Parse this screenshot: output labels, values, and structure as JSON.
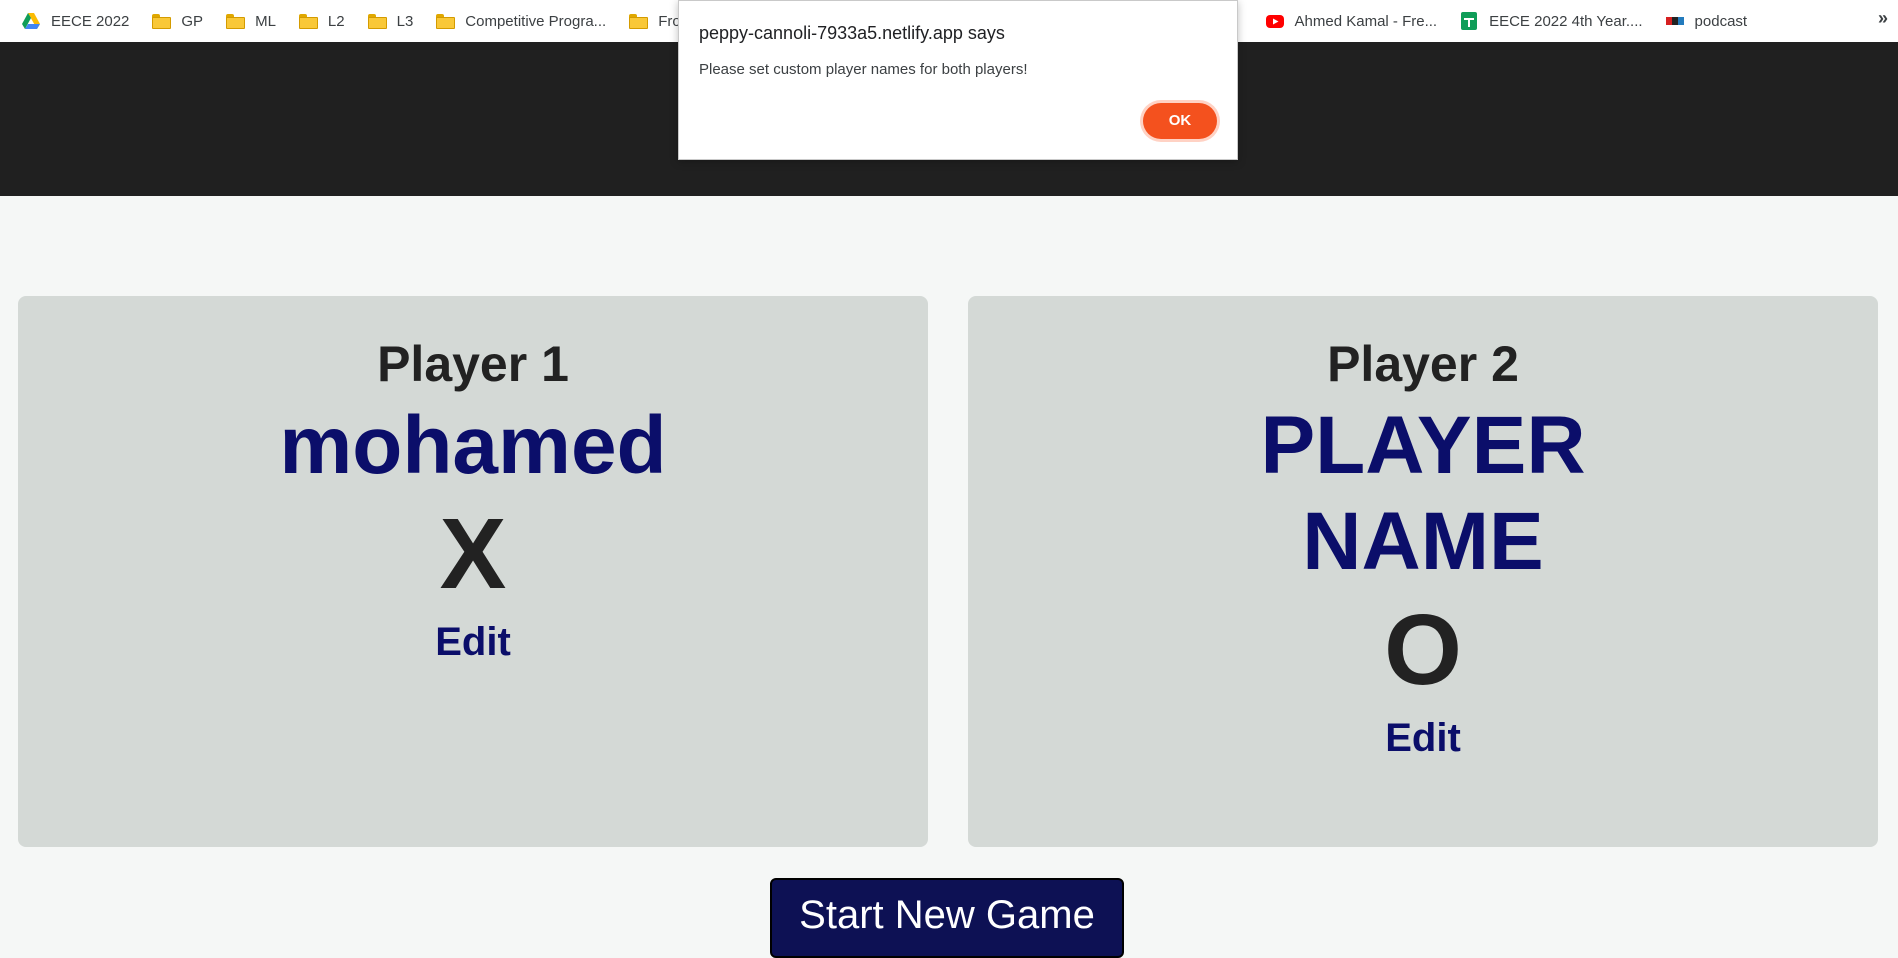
{
  "bookmarks": {
    "items": [
      {
        "label": "EECE 2022",
        "icon": "google-drive-icon"
      },
      {
        "label": "GP",
        "icon": "folder-icon"
      },
      {
        "label": "ML",
        "icon": "folder-icon"
      },
      {
        "label": "L2",
        "icon": "folder-icon"
      },
      {
        "label": "L3",
        "icon": "folder-icon"
      },
      {
        "label": "Competitive Progra...",
        "icon": "folder-icon"
      },
      {
        "label": "Front-e",
        "icon": "folder-icon"
      },
      {
        "label": "Ahmed Kamal - Fre...",
        "icon": "youtube-icon"
      },
      {
        "label": "EECE 2022 4th Year....",
        "icon": "google-sheets-icon"
      },
      {
        "label": "podcast",
        "icon": "npr-icon"
      }
    ],
    "more": "»"
  },
  "dialog": {
    "title": "peppy-cannoli-7933a5.netlify.app says",
    "message": "Please set custom player names for both players!",
    "ok_label": "OK",
    "ok_color": "#f4511e"
  },
  "players": [
    {
      "title": "Player 1",
      "name": "mohamed",
      "symbol": "X",
      "edit_label": "Edit"
    },
    {
      "title": "Player 2",
      "name": "PLAYER NAME",
      "symbol": "O",
      "edit_label": "Edit"
    }
  ],
  "start_button": "Start New Game",
  "colors": {
    "header_bg": "#202020",
    "card_bg": "#d4d9d6",
    "name_color": "#0b0e6a",
    "button_bg": "#0d1154"
  }
}
